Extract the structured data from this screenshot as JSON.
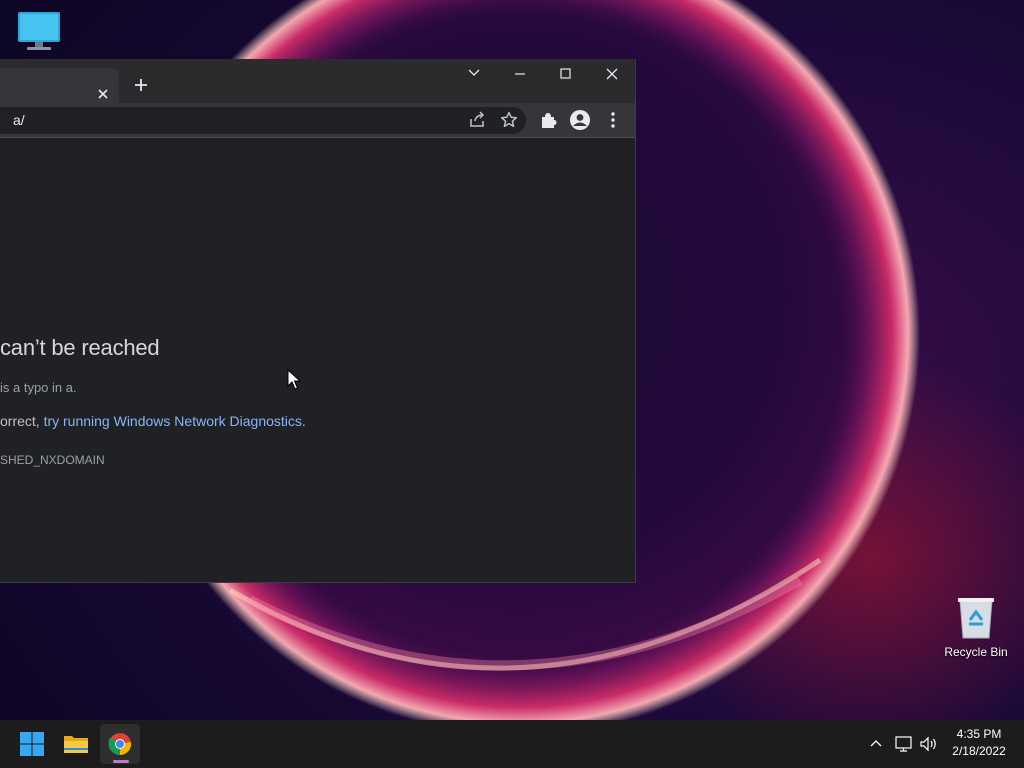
{
  "desktop": {
    "icons": [
      {
        "name": "this-pc",
        "label": ""
      },
      {
        "name": "recycle-bin",
        "label": "Recycle Bin"
      }
    ]
  },
  "browser": {
    "tab": {
      "title": "",
      "close_icon": "close-icon"
    },
    "new_tab_icon": "plus-icon",
    "window_controls": [
      "chevron-down-icon",
      "minimize-icon",
      "maximize-icon",
      "close-icon"
    ],
    "omnibox": {
      "url": "a/"
    },
    "toolbar_icons": [
      "share-icon",
      "star-icon",
      "extensions-icon",
      "profile-icon",
      "menu-icon"
    ],
    "error_page": {
      "title": "can’t be reached",
      "line1": "is a typo in a.",
      "line2_prefix": "orrect, ",
      "line2_link": "try running Windows Network Diagnostics",
      "line2_suffix": ".",
      "error_code": "SHED_NXDOMAIN"
    }
  },
  "taskbar": {
    "apps": [
      "windows-start-icon",
      "file-explorer-icon",
      "chrome-icon"
    ],
    "tray_icons": [
      "chevron-up-icon",
      "network-icon",
      "volume-icon"
    ],
    "clock": {
      "time": "4:35 PM",
      "date": "2/18/2022"
    }
  },
  "colors": {
    "link": "#8ab4f8",
    "window_bg": "#202124",
    "taskbar_bg": "#1c1c1c",
    "active_app_indicator": "#c17ac9"
  }
}
